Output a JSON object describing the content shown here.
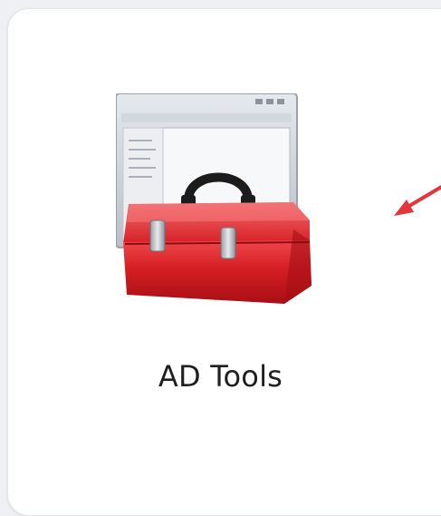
{
  "tile": {
    "label": "AD Tools",
    "icon": "toolbox-icon",
    "annotation": "red-arrow-pointer"
  },
  "colors": {
    "toolbox_red": "#d91f26",
    "arrow_red": "#e2363b",
    "tile_bg": "#ffffff",
    "page_bg": "#eef0f3"
  }
}
